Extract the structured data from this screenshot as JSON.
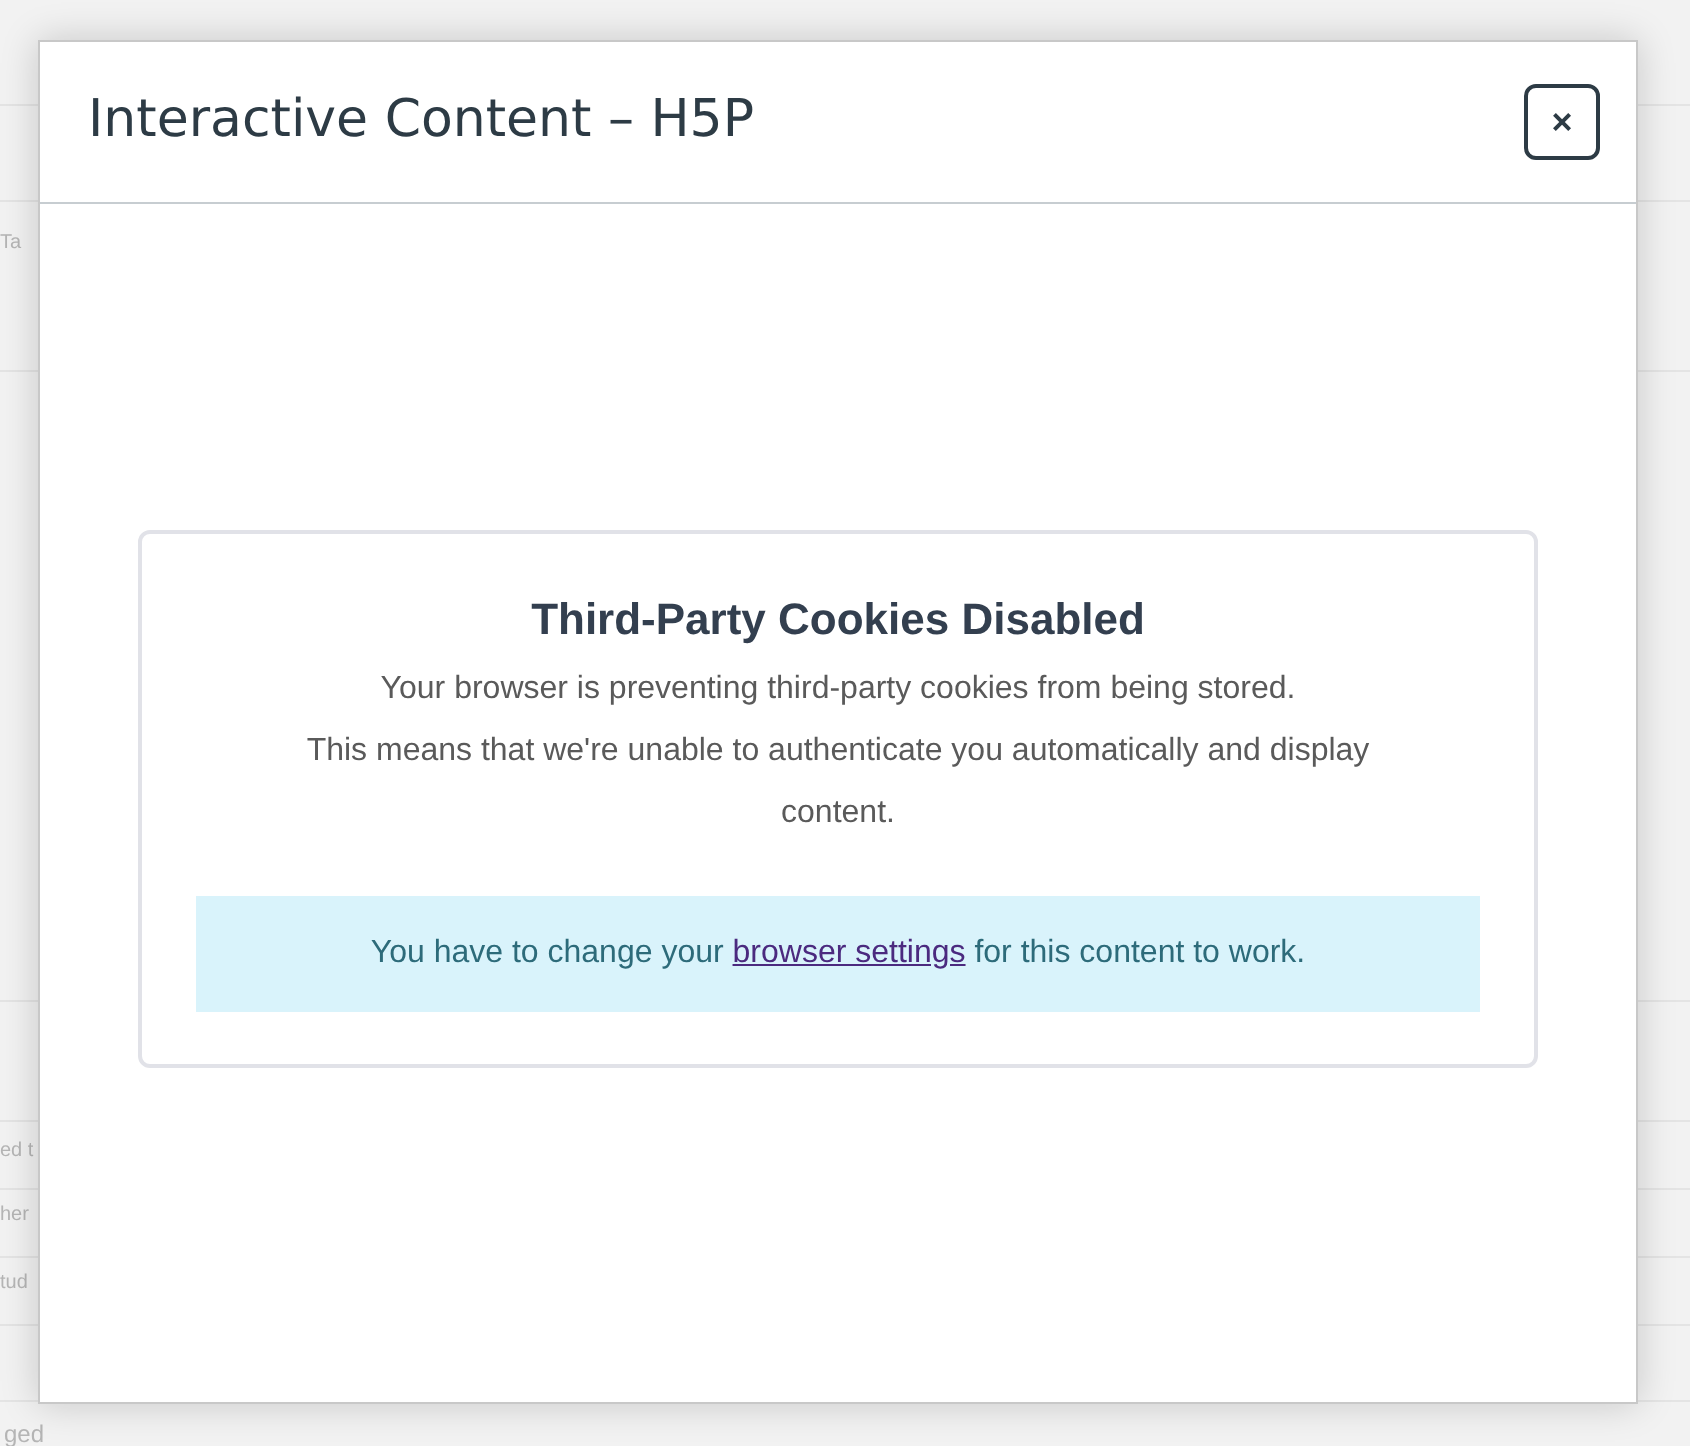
{
  "background": {
    "fragments": [
      {
        "text": "Ta"
      },
      {
        "text": "ed t"
      },
      {
        "text": "her"
      },
      {
        "text": "tud"
      },
      {
        "text": "ged"
      }
    ]
  },
  "modal": {
    "title": "Interactive Content – H5P",
    "close_label": "×"
  },
  "notice": {
    "heading": "Third-Party Cookies Disabled",
    "lines": [
      "Your browser is preventing third-party cookies from being stored.",
      "This means that we're unable to authenticate you automatically and display content."
    ],
    "info": {
      "before": "You have to change your ",
      "link": "browser settings",
      "after": " for this content to work."
    }
  }
}
